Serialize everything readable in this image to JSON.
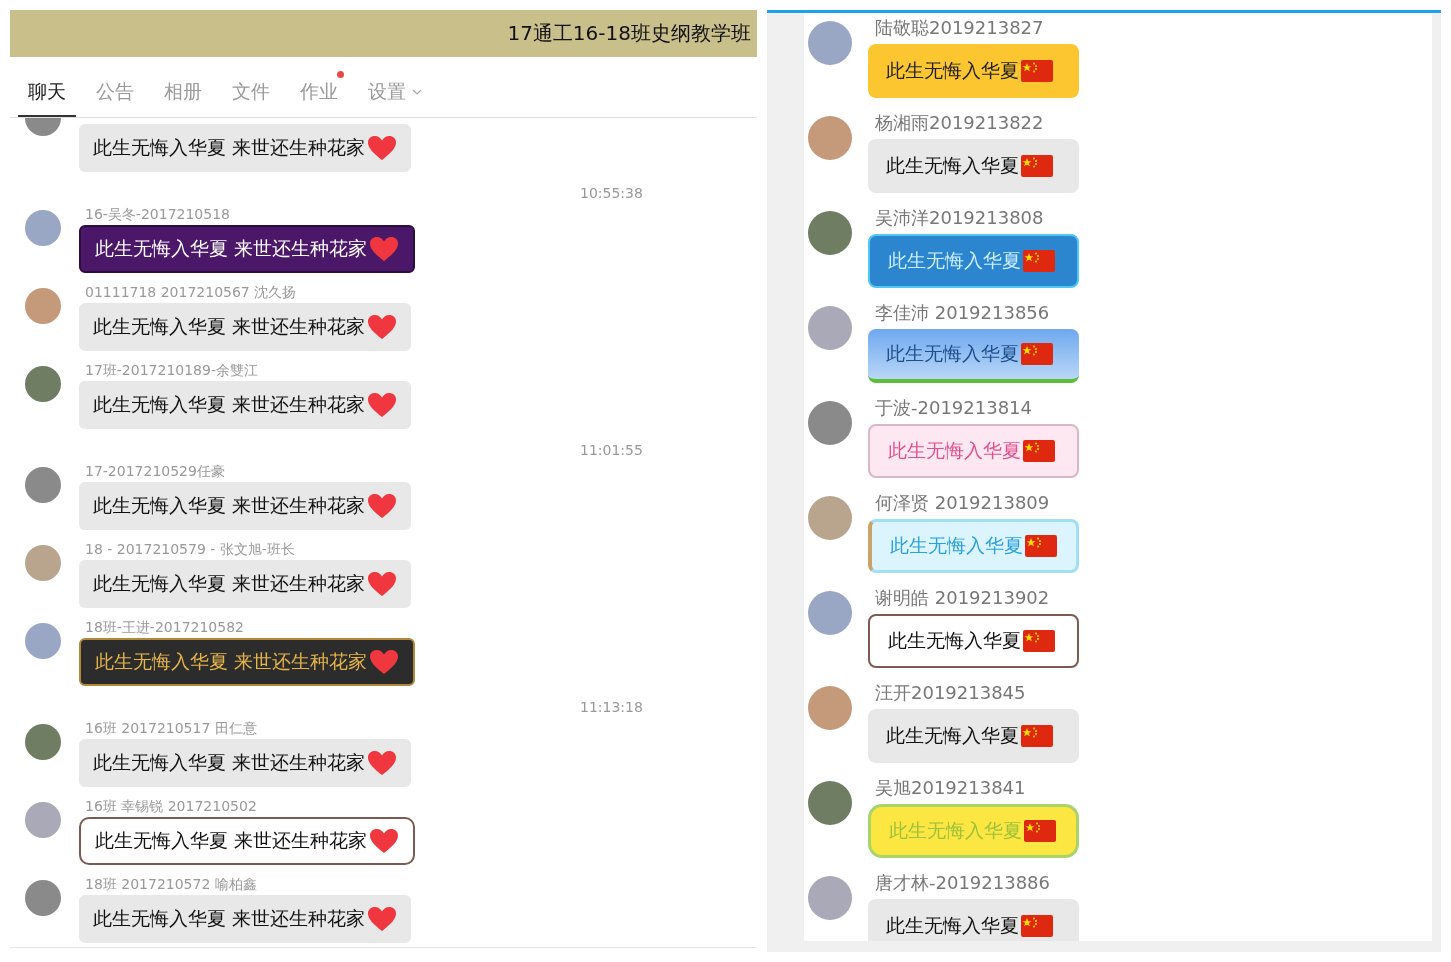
{
  "left_chat": {
    "group_title": "17通工16-18班史纲教学班",
    "tabs": [
      {
        "label": "聊天",
        "selected": true,
        "has_dot": false,
        "has_menu": false
      },
      {
        "label": "公告",
        "selected": false,
        "has_dot": false,
        "has_menu": false
      },
      {
        "label": "相册",
        "selected": false,
        "has_dot": false,
        "has_menu": false
      },
      {
        "label": "文件",
        "selected": false,
        "has_dot": false,
        "has_menu": false
      },
      {
        "label": "作业",
        "selected": false,
        "has_dot": true,
        "has_menu": false
      },
      {
        "label": "设置",
        "selected": false,
        "has_dot": false,
        "has_menu": true
      }
    ],
    "items": [
      {
        "kind": "message",
        "bubble": {
          "kind": "plain",
          "text": "此生无悔入华夏 来世还生种花家"
        }
      },
      {
        "kind": "time",
        "text": "10:55:38"
      },
      {
        "kind": "message",
        "name": "16-吴冬-2017210518",
        "bubble": {
          "kind": "purple",
          "text": "此生无悔入华夏 来世还生种花家"
        }
      },
      {
        "kind": "message",
        "name": "01111718 2017210567 沈久扬",
        "bubble": {
          "kind": "plain",
          "text": "此生无悔入华夏 来世还生种花家"
        }
      },
      {
        "kind": "message",
        "name": "17班-2017210189-余雙江",
        "bubble": {
          "kind": "plain",
          "text": "此生无悔入华夏 来世还生种花家"
        }
      },
      {
        "kind": "time",
        "text": "11:01:55"
      },
      {
        "kind": "message",
        "name": "17-2017210529任豪",
        "bubble": {
          "kind": "plain",
          "text": "此生无悔入华夏 来世还生种花家"
        }
      },
      {
        "kind": "message",
        "name": "18 - 2017210579 - 张文旭-班长",
        "bubble": {
          "kind": "plain",
          "text": "此生无悔入华夏 来世还生种花家"
        }
      },
      {
        "kind": "message",
        "name": "18班-王进-2017210582",
        "bubble": {
          "kind": "dark",
          "text": "此生无悔入华夏 来世还生种花家"
        }
      },
      {
        "kind": "time",
        "text": "11:13:18"
      },
      {
        "kind": "message",
        "name": "16班 2017210517 田仁意",
        "bubble": {
          "kind": "plain",
          "text": "此生无悔入华夏 来世还生种花家"
        }
      },
      {
        "kind": "message",
        "name": "16班 幸锡锐 2017210502",
        "bubble": {
          "kind": "outline",
          "text": "此生无悔入华夏 来世还生种花家"
        }
      },
      {
        "kind": "message",
        "name": "18班 2017210572 喻柏鑫",
        "bubble": {
          "kind": "plain",
          "text": "此生无悔入华夏 来世还生种花家"
        }
      }
    ]
  },
  "right_chat": {
    "messages": [
      {
        "name": "陆敬聪2019213827",
        "bubble": {
          "kind": "yellow",
          "text": "此生无悔入华夏"
        }
      },
      {
        "name": "杨湘雨2019213822",
        "bubble": {
          "kind": "plain",
          "text": "此生无悔入华夏"
        }
      },
      {
        "name": "吴沛洋2019213808",
        "bubble": {
          "kind": "blue",
          "text": "此生无悔入华夏"
        }
      },
      {
        "name": "李佳沛 2019213856",
        "bubble": {
          "kind": "sky",
          "text": "此生无悔入华夏"
        }
      },
      {
        "name": "于波-2019213814",
        "bubble": {
          "kind": "pink",
          "text": "此生无悔入华夏"
        }
      },
      {
        "name": "何泽贤 2019213809",
        "bubble": {
          "kind": "cyan",
          "text": "此生无悔入华夏"
        }
      },
      {
        "name": "谢明皓 2019213902",
        "bubble": {
          "kind": "brown",
          "text": "此生无悔入华夏"
        }
      },
      {
        "name": "汪开2019213845",
        "bubble": {
          "kind": "plain",
          "text": "此生无悔入华夏"
        }
      },
      {
        "name": "吴旭2019213841",
        "bubble": {
          "kind": "lemon",
          "text": "此生无悔入华夏"
        }
      },
      {
        "name": "唐才林-2019213886",
        "bubble": {
          "kind": "plain",
          "text": "此生无悔入华夏"
        }
      }
    ]
  }
}
